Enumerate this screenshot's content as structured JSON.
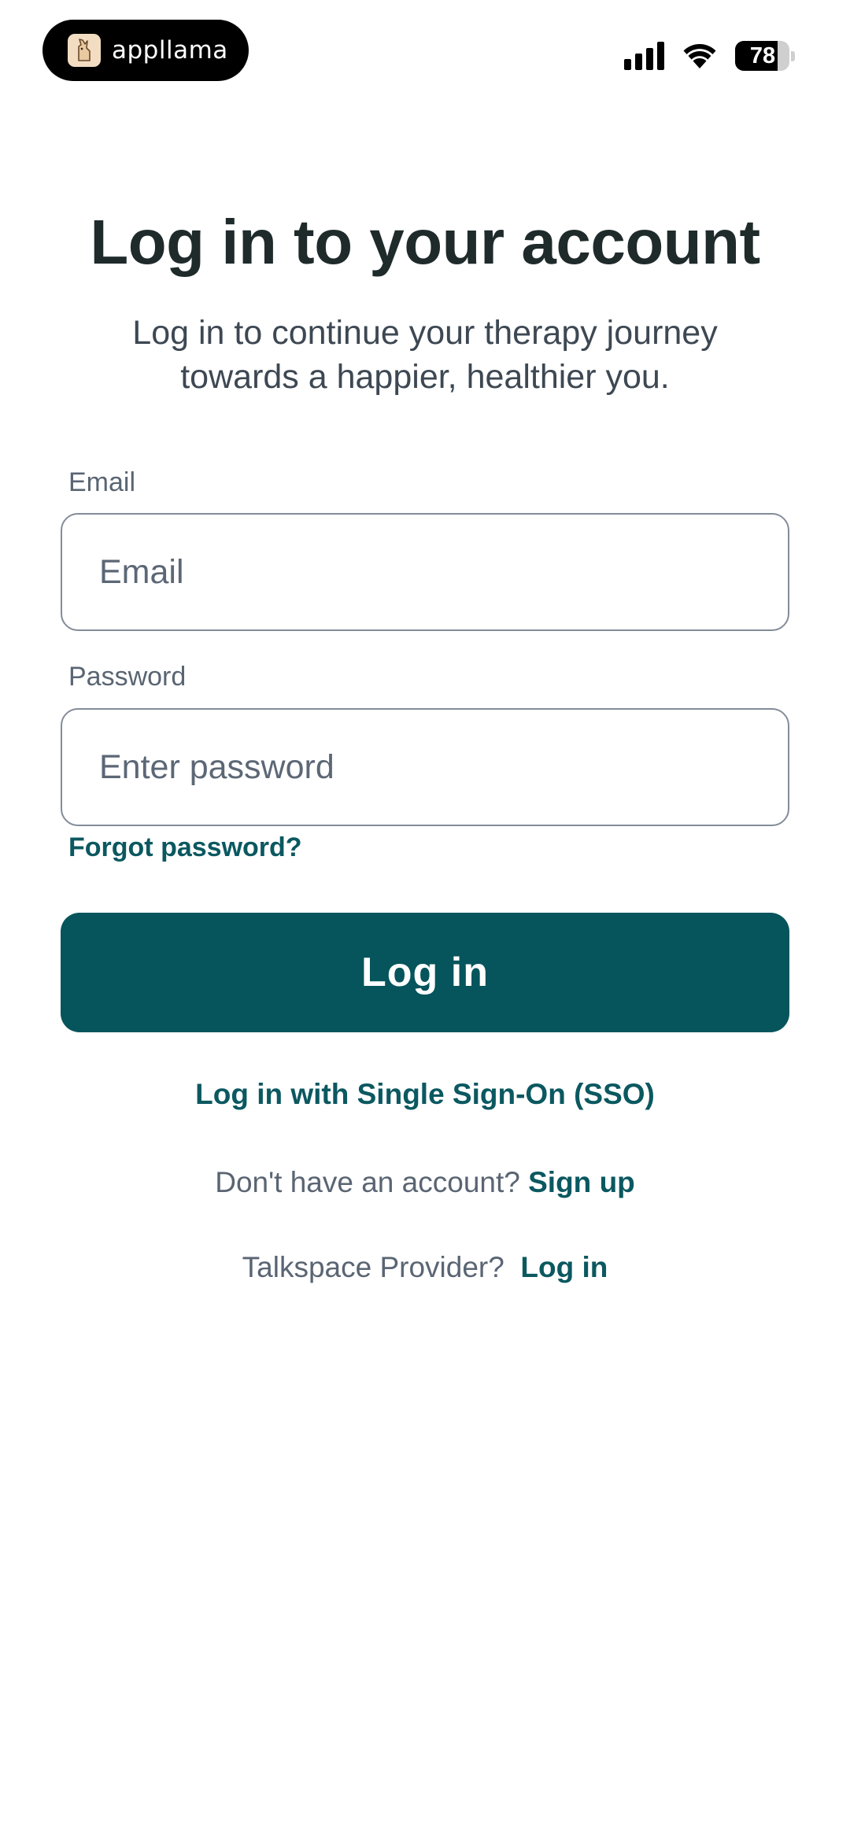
{
  "status_bar": {
    "app_name": "appllama",
    "battery_percent": "78",
    "battery_level": 0.78,
    "icons": [
      "cellular-signal-icon",
      "wifi-icon",
      "battery-icon"
    ]
  },
  "header": {
    "title": "Log in to your account",
    "subtitle": "Log in to continue your therapy journey towards a happier, healthier you."
  },
  "form": {
    "email": {
      "label": "Email",
      "value": "",
      "placeholder": "Email"
    },
    "password": {
      "label": "Password",
      "value": "",
      "placeholder": "Enter password"
    },
    "forgot_password": "Forgot password?",
    "login_button": "Log in"
  },
  "links": {
    "sso": "Log in with Single Sign-On (SSO)",
    "signup_prompt": "Don't have an account?",
    "signup_link": "Sign up",
    "provider_prompt": "Talkspace Provider?",
    "provider_link": "Log in"
  },
  "colors": {
    "primary": "#06545c",
    "link": "#0b5860",
    "title": "#1f2a2b",
    "muted": "#5a6573",
    "border": "#838c99"
  }
}
